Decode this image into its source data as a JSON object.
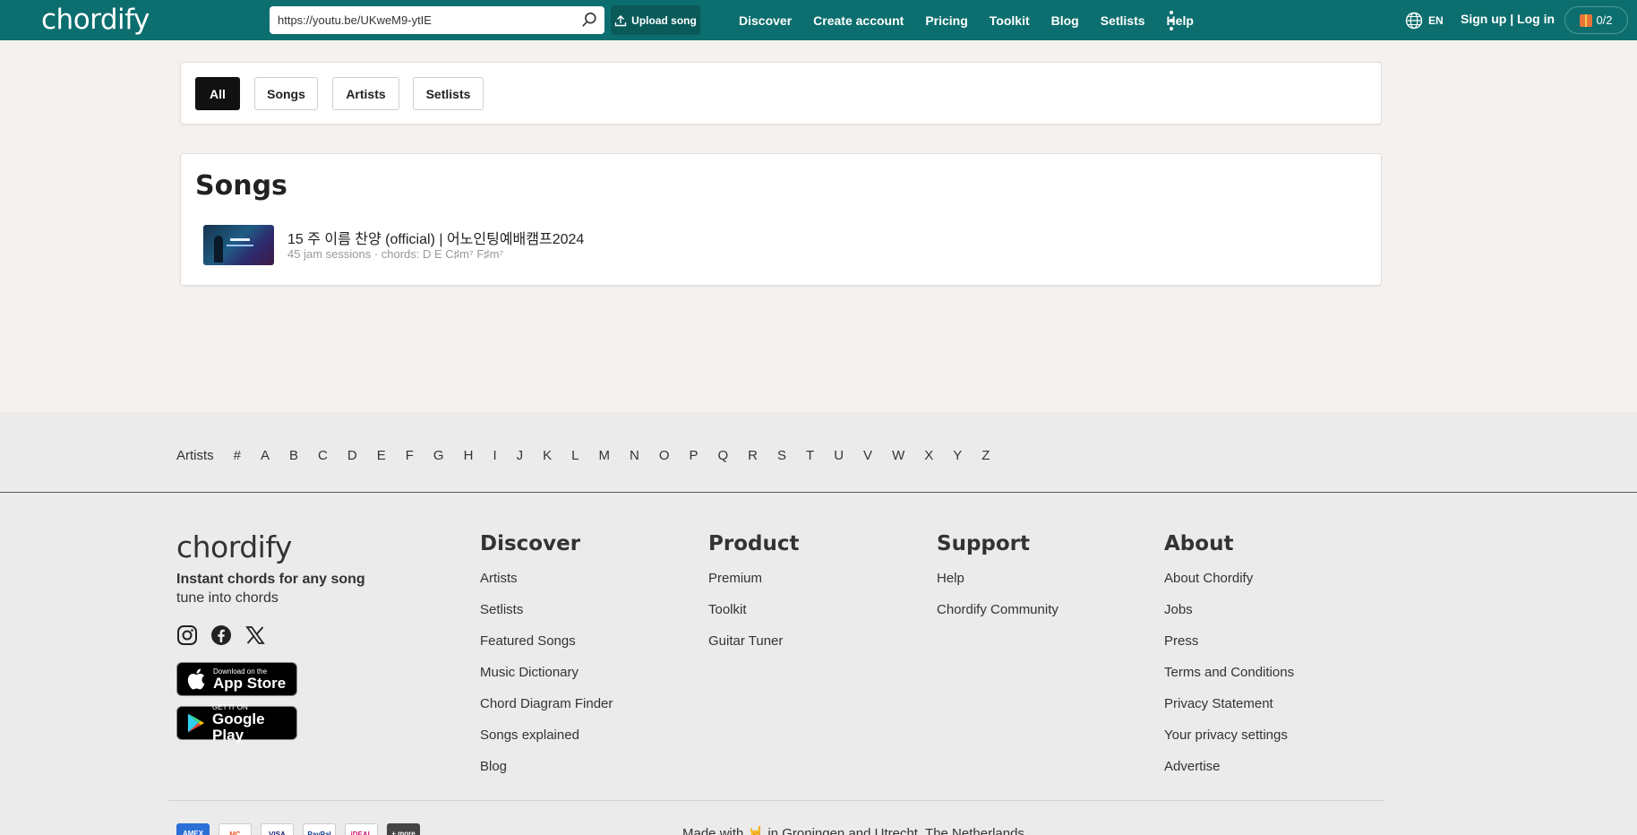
{
  "header": {
    "logo": "chordify",
    "search_value": "https://youtu.be/UKweM9-ytIE",
    "upload_label": "Upload song",
    "nav": [
      "Discover",
      "Create account",
      "Pricing",
      "Toolkit",
      "Blog",
      "Setlists",
      "Help"
    ],
    "language": "EN",
    "auth": "Sign up | Log in",
    "gift_count": "0/2"
  },
  "filters": [
    "All",
    "Songs",
    "Artists",
    "Setlists"
  ],
  "filters_active": "All",
  "songs": {
    "heading": "Songs",
    "items": [
      {
        "title": "15 주 이름 찬양 (official) | 어노인팅예배캠프2024",
        "meta": "45 jam sessions · chords:  D E C♯m⁷ F♯m⁷"
      }
    ]
  },
  "letters": {
    "label": "Artists",
    "items": [
      "#",
      "A",
      "B",
      "C",
      "D",
      "E",
      "F",
      "G",
      "H",
      "I",
      "J",
      "K",
      "L",
      "M",
      "N",
      "O",
      "P",
      "Q",
      "R",
      "S",
      "T",
      "U",
      "V",
      "W",
      "X",
      "Y",
      "Z"
    ]
  },
  "footer": {
    "logo": "chordify",
    "tagline": "Instant chords for any song",
    "tagline2": "tune into chords",
    "social_icons": [
      "instagram-icon",
      "facebook-icon",
      "x-icon"
    ],
    "app_store": {
      "small": "Download on the",
      "big": "App Store"
    },
    "google_play": {
      "small": "GET IT ON",
      "big": "Google Play"
    },
    "columns": [
      {
        "title": "Discover",
        "links": [
          "Artists",
          "Setlists",
          "Featured Songs",
          "Music Dictionary",
          "Chord Diagram Finder",
          "Songs explained",
          "Blog"
        ]
      },
      {
        "title": "Product",
        "links": [
          "Premium",
          "Toolkit",
          "Guitar Tuner"
        ]
      },
      {
        "title": "Support",
        "links": [
          "Help",
          "Chordify Community"
        ]
      },
      {
        "title": "About",
        "links": [
          "About Chordify",
          "Jobs",
          "Press",
          "Terms and Conditions",
          "Privacy Statement",
          "Your privacy settings",
          "Advertise"
        ]
      }
    ],
    "payments": [
      "AMEX",
      "MC",
      "VISA",
      "PayPal",
      "iDEAL",
      "+ more"
    ],
    "made_with": "Made with 🤘 in Groningen and Utrecht, The Netherlands"
  },
  "colors": {
    "brand": "#0c6e6e",
    "page_bg": "#f4f1ee",
    "footer_bg": "#ebebeb"
  }
}
